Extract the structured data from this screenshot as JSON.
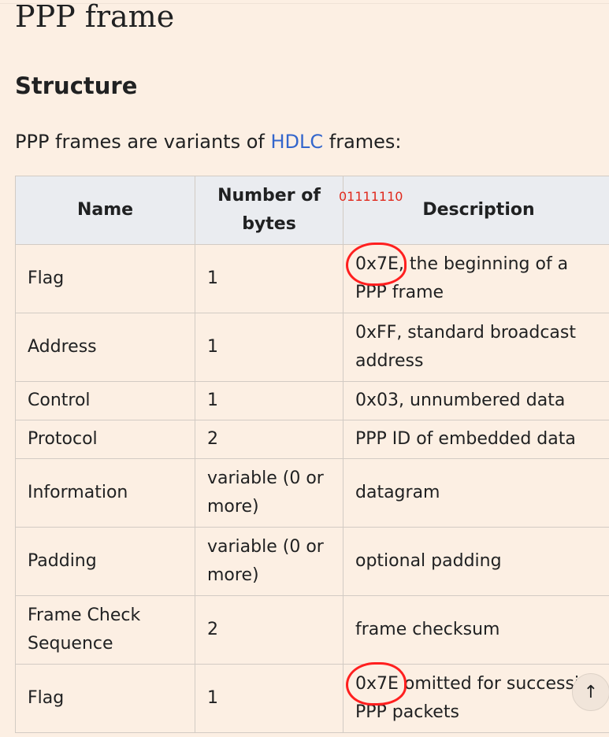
{
  "page_title": "PPP frame",
  "section_heading": "Structure",
  "intro": {
    "before": "PPP frames are variants of ",
    "link": "HDLC",
    "after": " frames:"
  },
  "annotation": "01111110",
  "table": {
    "headers": [
      "Name",
      "Number of bytes",
      "Description"
    ],
    "rows": [
      {
        "name": "Flag",
        "bytes": "1",
        "desc_highlight": "0x7E",
        "desc_rest": ", the beginning of a PPP frame"
      },
      {
        "name": "Address",
        "bytes": "1",
        "desc": "0xFF, standard broadcast address"
      },
      {
        "name": "Control",
        "bytes": "1",
        "desc": "0x03, unnumbered data"
      },
      {
        "name": "Protocol",
        "bytes": "2",
        "desc": "PPP ID of embedded data"
      },
      {
        "name": "Information",
        "bytes": "variable (0 or more)",
        "desc": "datagram"
      },
      {
        "name": "Padding",
        "bytes": "variable (0 or more)",
        "desc": "optional padding"
      },
      {
        "name": "Frame Check Sequence",
        "bytes": "2",
        "desc": "frame checksum"
      },
      {
        "name": "Flag",
        "bytes": "1",
        "desc_highlight": "0x7E",
        "desc_rest": " omitted for successive PPP packets"
      }
    ]
  },
  "scroll_top_icon": "arrow-up-icon",
  "scroll_top_glyph": "↑",
  "colors": {
    "background": "#fcefe3",
    "header_bg": "#eaecf0",
    "link": "#3366cc",
    "annotation": "#e0281c"
  }
}
